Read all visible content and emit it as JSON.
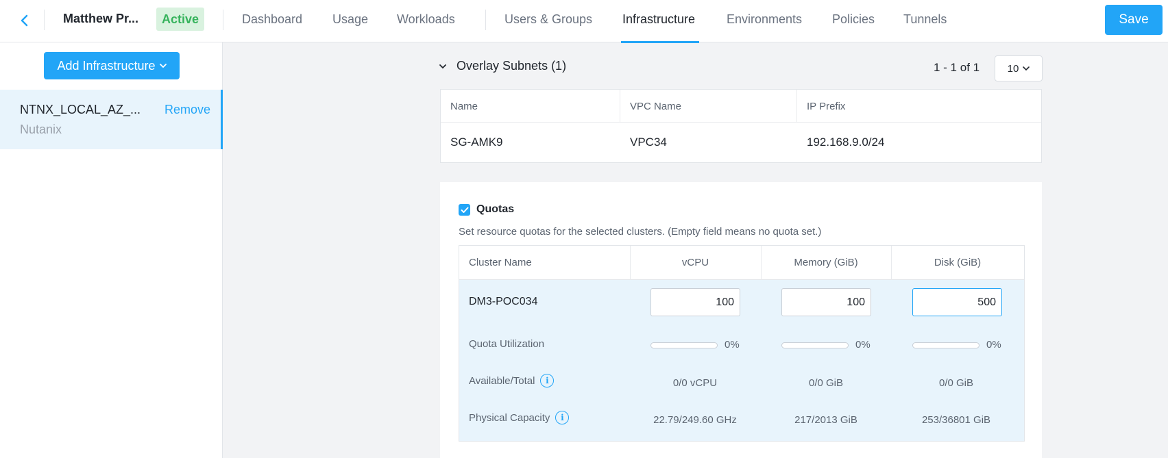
{
  "header": {
    "project_name": "Matthew Pr...",
    "status": "Active",
    "tabs": [
      {
        "label": "Dashboard"
      },
      {
        "label": "Usage"
      },
      {
        "label": "Workloads"
      },
      {
        "label": "Users & Groups"
      },
      {
        "label": "Infrastructure",
        "active": true
      },
      {
        "label": "Environments"
      },
      {
        "label": "Policies"
      },
      {
        "label": "Tunnels"
      }
    ],
    "save_label": "Save"
  },
  "sidebar": {
    "add_button_label": "Add Infrastructure",
    "items": [
      {
        "name": "NTNX_LOCAL_AZ_...",
        "type": "Nutanix",
        "remove_label": "Remove"
      }
    ]
  },
  "subnets": {
    "title": "Overlay Subnets (1)",
    "pager": "1 - 1 of 1",
    "page_size": "10",
    "columns": [
      "Name",
      "VPC Name",
      "IP Prefix"
    ],
    "rows": [
      {
        "name": "SG-AMK9",
        "vpc": "VPC34",
        "prefix": "192.168.9.0/24"
      }
    ]
  },
  "quotas": {
    "label": "Quotas",
    "checked": true,
    "description": "Set resource quotas for the selected clusters. (Empty field means no quota set.)",
    "columns": [
      "Cluster Name",
      "vCPU",
      "Memory (GiB)",
      "Disk (GiB)"
    ],
    "cluster_name": "DM3-POC034",
    "inputs": {
      "vcpu": "100",
      "memory": "100",
      "disk": "500"
    },
    "utilization_label": "Quota Utilization",
    "utilization": {
      "vcpu": "0%",
      "memory": "0%",
      "disk": "0%"
    },
    "available_label": "Available/Total",
    "available": {
      "vcpu": "0/0 vCPU",
      "memory": "0/0 GiB",
      "disk": "0/0 GiB"
    },
    "physical_label": "Physical Capacity",
    "physical": {
      "vcpu": "22.79/249.60 GHz",
      "memory": "217/2013 GiB",
      "disk": "253/36801 GiB"
    }
  },
  "colors": {
    "accent": "#22a5f7",
    "status": "#36b35c",
    "selected_bg": "#e8f4fc"
  }
}
